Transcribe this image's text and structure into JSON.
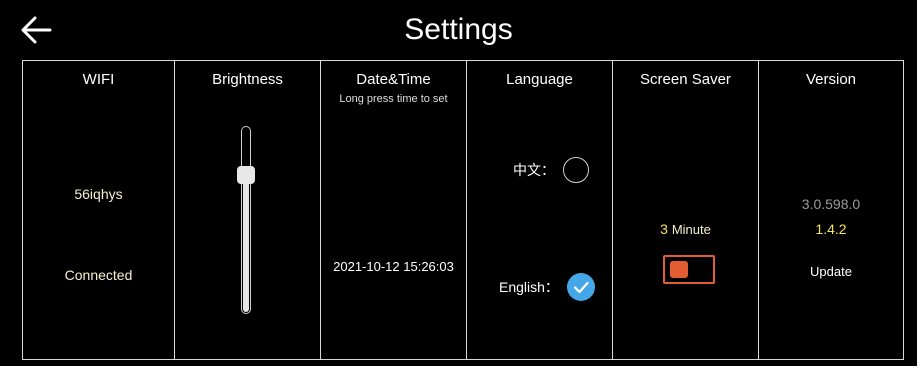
{
  "header": {
    "title": "Settings",
    "back_icon": "arrow-left-icon"
  },
  "wifi": {
    "label": "WIFI",
    "ssid": "56iqhys",
    "status": "Connected"
  },
  "brightness": {
    "label": "Brightness",
    "level": 0.75
  },
  "datetime": {
    "label": "Date&Time",
    "hint": "Long press time to set",
    "value": "2021-10-12 15:26:03"
  },
  "language": {
    "label": "Language",
    "options": [
      {
        "label": "中文：",
        "selected": false
      },
      {
        "label": "English：",
        "selected": true
      }
    ]
  },
  "screen_saver": {
    "label": "Screen Saver",
    "minutes": "3",
    "unit": "Minute",
    "enabled": false
  },
  "version": {
    "label": "Version",
    "build": "3.0.598.0",
    "app_version": "1.4.2",
    "update_label": "Update"
  },
  "colors": {
    "background": "#000000",
    "accent_yellow": "#f5e15a",
    "toggle_orange": "#e35d33",
    "check_blue": "#46a7e8"
  }
}
